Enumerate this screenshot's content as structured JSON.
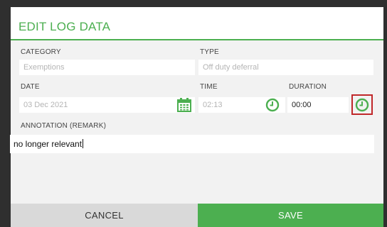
{
  "dialog": {
    "title": "EDIT LOG DATA"
  },
  "fields": {
    "category": {
      "label": "CATEGORY",
      "value": "Exemptions"
    },
    "type": {
      "label": "TYPE",
      "value": "Off duty deferral"
    },
    "date": {
      "label": "DATE",
      "value": "03 Dec 2021"
    },
    "time": {
      "label": "TIME",
      "value": "02:13"
    },
    "duration": {
      "label": "DURATION",
      "value": "00:00"
    },
    "annotation": {
      "label": "ANNOTATION (REMARK)",
      "value": "no longer relevant"
    }
  },
  "buttons": {
    "cancel": "CANCEL",
    "save": "SAVE"
  },
  "icons": {
    "date": "calendar-icon",
    "time": "clock-icon",
    "duration": "clock-icon"
  },
  "colors": {
    "accent": "#4caf50",
    "highlight": "#c0282a"
  }
}
